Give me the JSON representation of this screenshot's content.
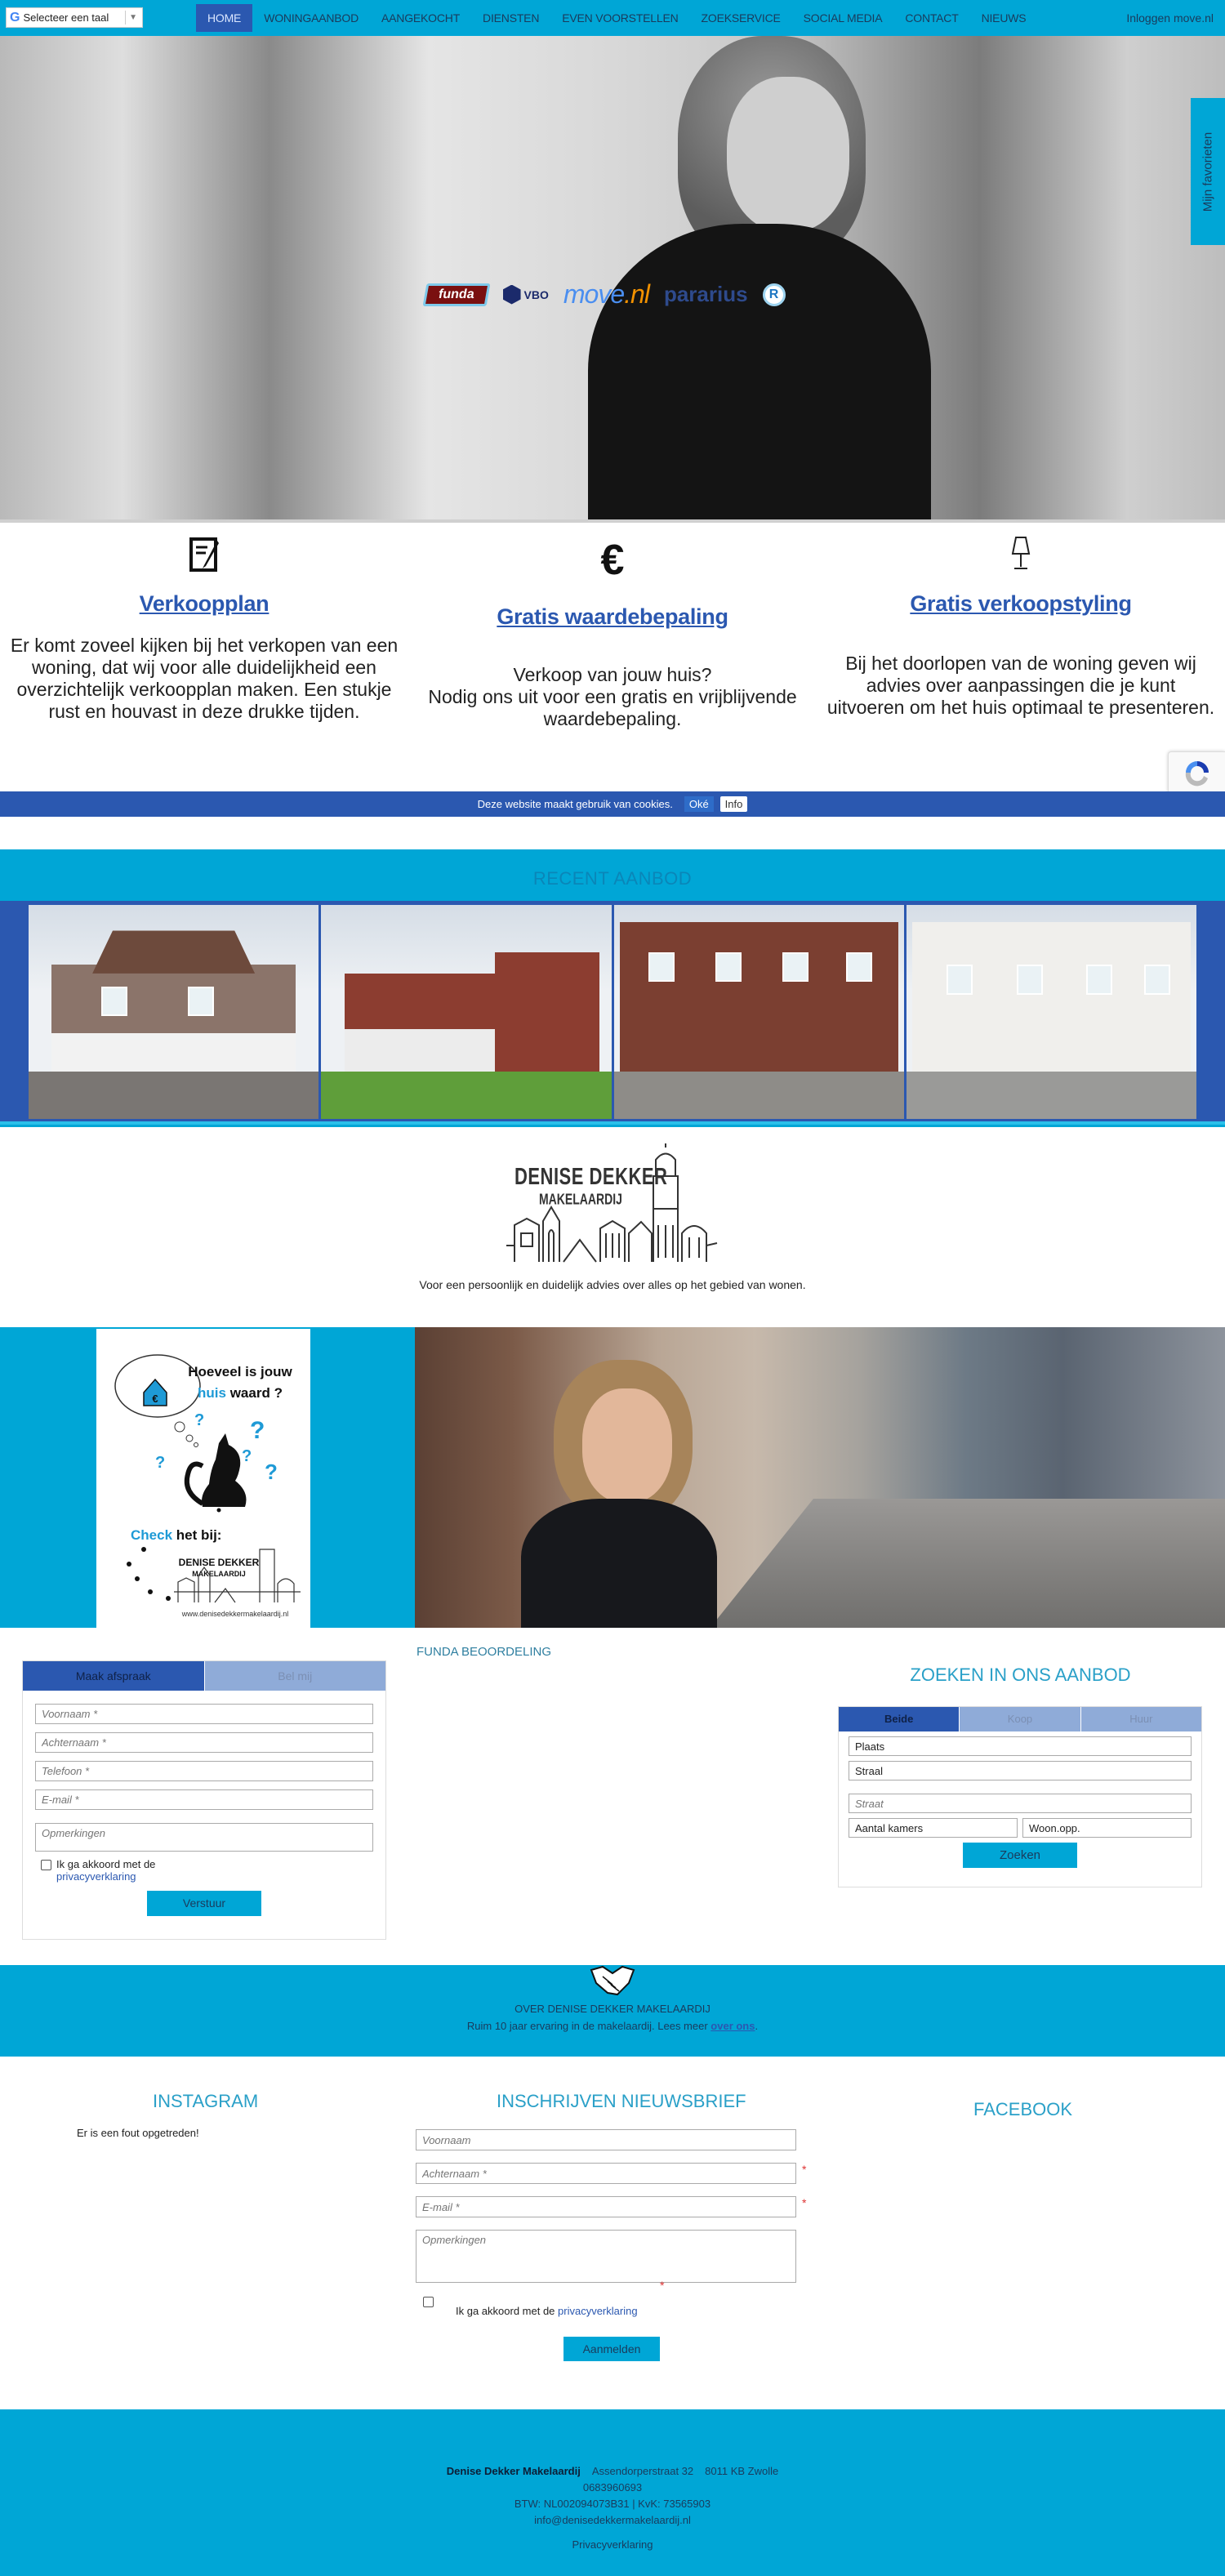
{
  "nav": {
    "language_selector": "Selecteer een taal",
    "items": [
      {
        "label": "HOME",
        "active": true
      },
      {
        "label": "WONINGAANBOD",
        "active": false
      },
      {
        "label": "AANGEKOCHT",
        "active": false
      },
      {
        "label": "DIENSTEN",
        "active": false
      },
      {
        "label": "EVEN VOORSTELLEN",
        "active": false
      },
      {
        "label": "ZOEKSERVICE",
        "active": false
      },
      {
        "label": "SOCIAL MEDIA",
        "active": false
      },
      {
        "label": "CONTACT",
        "active": false
      },
      {
        "label": "NIEUWS",
        "active": false
      }
    ],
    "login": "Inloggen move.nl"
  },
  "hero": {
    "partner_logos": [
      "funda",
      "VBO",
      "move.nl",
      "pararius",
      "R"
    ],
    "favorites_tab": "Mijn favorieten"
  },
  "services": [
    {
      "icon": "notepad-icon",
      "title": "Verkoopplan",
      "text": "Er komt zoveel kijken bij het verkopen van een woning, dat wij voor alle duidelijkheid een overzichtelijk verkoopplan maken. Een stukje rust en houvast in deze drukke tijden."
    },
    {
      "icon": "euro-icon",
      "title": "Gratis waardebepaling",
      "text_line1": "Verkoop van jouw huis?",
      "text_line2": "Nodig ons uit voor een gratis en vrijblijvende waardebepaling."
    },
    {
      "icon": "lamp-icon",
      "title": "Gratis verkoopstyling",
      "text": "Bij het doorlopen van de woning geven wij advies over aanpassingen die je kunt uitvoeren om het huis optimaal te presenteren."
    }
  ],
  "cookie": {
    "message": "Deze website maakt gebruik van cookies.",
    "ok": "Oké",
    "info": "Info"
  },
  "recent": {
    "title": "RECENT AANBOD",
    "listings_count": 4
  },
  "brand": {
    "logo_line1": "DENISE DEKKER",
    "logo_line2": "MAKELAARDIJ",
    "tagline": "Voor een persoonlijk en duidelijk advies over alles op het gebied van wonen."
  },
  "promo": {
    "line1": "Hoeveel is jouw",
    "line2_highlight": "huis",
    "line2_rest": "waard ?",
    "check_highlight": "Check",
    "check_rest": "het bij:",
    "logo_line1": "DENISE DEKKER",
    "logo_line2": "MAKELAARDIJ",
    "url": "www.denisedekkermakelaardij.nl",
    "accent_color": "#1e9ad6"
  },
  "appointment": {
    "tabs": [
      "Maak afspraak",
      "Bel mij"
    ],
    "active_tab": 0,
    "fields": {
      "firstname": "Voornaam *",
      "lastname": "Achternaam *",
      "phone": "Telefoon *",
      "email": "E-mail *",
      "remarks": "Opmerkingen"
    },
    "agree_text": "Ik ga akkoord met de",
    "agree_link": "privacyverklaring",
    "submit": "Verstuur"
  },
  "funda": {
    "title": "FUNDA BEOORDELING"
  },
  "search": {
    "title": "ZOEKEN IN ONS AANBOD",
    "tabs": [
      "Beide",
      "Koop",
      "Huur"
    ],
    "active_tab": 0,
    "place_value": "Plaats",
    "street_select": "Straal",
    "street_placeholder": "Straat",
    "rooms_value": "Aantal kamers",
    "area_value": "Woon.opp.",
    "submit": "Zoeken"
  },
  "about": {
    "title": "OVER DENISE DEKKER MAKELAARDIJ",
    "text": "Ruim 10 jaar ervaring in de makelaardij. Lees meer ",
    "link": "over ons",
    "suffix": "."
  },
  "instagram": {
    "title": "INSTAGRAM",
    "error": "Er is een fout opgetreden!"
  },
  "newsletter": {
    "title": "INSCHRIJVEN NIEUWSBRIEF",
    "fields": {
      "firstname": "Voornaam",
      "lastname": "Achternaam *",
      "email": "E-mail *",
      "remarks": "Opmerkingen"
    },
    "required_mark": "*",
    "agree_text": "Ik ga akkoord met de ",
    "agree_link": "privacyverklaring",
    "submit": "Aanmelden"
  },
  "facebook": {
    "title": "FACEBOOK"
  },
  "footer": {
    "company": "Denise Dekker Makelaardij",
    "address": "Assendorperstraat 32",
    "city": "8011 KB Zwolle",
    "phone": "0683960693",
    "registration": "BTW: NL002094073B31 | KvK: 73565903",
    "email": "info@denisedekkermakelaardij.nl",
    "privacy": "Privacyverklaring"
  },
  "colors": {
    "brand_cyan": "#00a6d6",
    "brand_blue": "#2b58b0",
    "tab_inactive": "#8fabd8",
    "heading_teal": "#2aa0c8"
  }
}
